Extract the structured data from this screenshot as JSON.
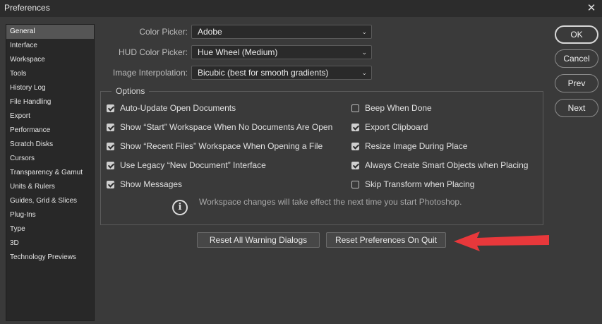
{
  "window": {
    "title": "Preferences"
  },
  "sidebar": {
    "items": [
      {
        "label": "General",
        "selected": true
      },
      {
        "label": "Interface"
      },
      {
        "label": "Workspace"
      },
      {
        "label": "Tools"
      },
      {
        "label": "History Log"
      },
      {
        "label": "File Handling"
      },
      {
        "label": "Export"
      },
      {
        "label": "Performance"
      },
      {
        "label": "Scratch Disks"
      },
      {
        "label": "Cursors"
      },
      {
        "label": "Transparency & Gamut"
      },
      {
        "label": "Units & Rulers"
      },
      {
        "label": "Guides, Grid & Slices"
      },
      {
        "label": "Plug-Ins"
      },
      {
        "label": "Type"
      },
      {
        "label": "3D"
      },
      {
        "label": "Technology Previews"
      }
    ]
  },
  "general": {
    "color_picker": {
      "label": "Color Picker:",
      "value": "Adobe"
    },
    "hud_color_picker": {
      "label": "HUD Color Picker:",
      "value": "Hue Wheel (Medium)"
    },
    "image_interpolation": {
      "label": "Image Interpolation:",
      "value": "Bicubic (best for smooth gradients)"
    }
  },
  "options": {
    "title": "Options",
    "left": [
      {
        "label": "Auto-Update Open Documents",
        "checked": true
      },
      {
        "label": "Show “Start” Workspace When No Documents Are Open",
        "checked": true
      },
      {
        "label": "Show “Recent Files” Workspace When Opening a File",
        "checked": true
      },
      {
        "label": "Use Legacy “New Document” Interface",
        "checked": true
      },
      {
        "label": "Show Messages",
        "checked": true
      }
    ],
    "right": [
      {
        "label": "Beep When Done",
        "checked": false
      },
      {
        "label": "Export Clipboard",
        "checked": true
      },
      {
        "label": "Resize Image During Place",
        "checked": true
      },
      {
        "label": "Always Create Smart Objects when Placing",
        "checked": true
      },
      {
        "label": "Skip Transform when Placing",
        "checked": false
      }
    ],
    "info": "Workspace changes will take effect the next time you start Photoshop."
  },
  "buttons": {
    "reset_warning": "Reset All Warning Dialogs",
    "reset_prefs": "Reset Preferences On Quit",
    "ok": "OK",
    "cancel": "Cancel",
    "prev": "Prev",
    "next": "Next"
  },
  "colors": {
    "dialog_bg": "#3a3a3a",
    "annotation_arrow": "#e8383b"
  }
}
